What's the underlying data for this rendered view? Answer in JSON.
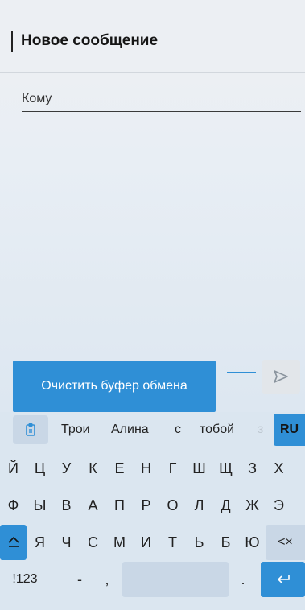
{
  "header": {
    "title": "Новое сообщение"
  },
  "compose": {
    "to_label": "Кому"
  },
  "clipboard": {
    "clear_label": "Очистить буфер обмена"
  },
  "keyboard": {
    "suggestions": [
      "Трои",
      "Алина",
      "с",
      "тобой",
      "з"
    ],
    "language": "RU",
    "row1": [
      "Й",
      "Ц",
      "У",
      "К",
      "Е",
      "Н",
      "Г",
      "Ш",
      "Щ",
      "З",
      "Х"
    ],
    "row2": [
      "Ф",
      "Ы",
      "В",
      "А",
      "П",
      "Р",
      "О",
      "Л",
      "Д",
      "Ж",
      "Э"
    ],
    "row3": [
      "Я",
      "Ч",
      "С",
      "М",
      "И",
      "Т",
      "Ь",
      "Б",
      "Ю"
    ],
    "backspace_label": "<×",
    "symbols_label": "!123",
    "dash_label": "-",
    "comma_label": ",",
    "period_label": "."
  },
  "colors": {
    "accent": "#2f8fd6",
    "background": "#dbe6f0"
  }
}
